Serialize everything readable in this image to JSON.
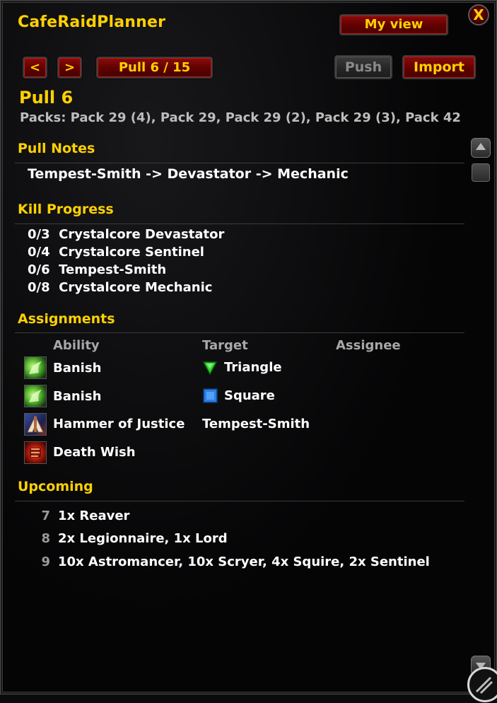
{
  "window": {
    "title": "CafeRaidPlanner",
    "close_glyph": "X"
  },
  "header": {
    "my_view_label": "My view",
    "prev_label": "<",
    "next_label": ">",
    "pull_indicator": "Pull 6 / 15",
    "push_label": "Push",
    "import_label": "Import"
  },
  "pull": {
    "title": "Pull 6",
    "packs": "Packs: Pack 29 (4), Pack 29, Pack 29 (2), Pack 29 (3), Pack 42"
  },
  "pull_notes": {
    "heading": "Pull Notes",
    "text": "Tempest-Smith -> Devastator -> Mechanic"
  },
  "kill_progress": {
    "heading": "Kill Progress",
    "items": [
      {
        "count": "0/3",
        "name": "Crystalcore Devastator"
      },
      {
        "count": "0/4",
        "name": "Crystalcore Sentinel"
      },
      {
        "count": "0/6",
        "name": "Tempest-Smith"
      },
      {
        "count": "0/8",
        "name": "Crystalcore Mechanic"
      }
    ]
  },
  "assignments": {
    "heading": "Assignments",
    "columns": {
      "ability": "Ability",
      "target": "Target",
      "assignee": "Assignee"
    },
    "rows": [
      {
        "icon": "banish-icon",
        "ability": "Banish",
        "target_icon": "triangle-marker-icon",
        "target": "Triangle",
        "assignee": ""
      },
      {
        "icon": "banish-icon",
        "ability": "Banish",
        "target_icon": "square-marker-icon",
        "target": "Square",
        "assignee": ""
      },
      {
        "icon": "hammer-of-justice-icon",
        "ability": "Hammer of Justice",
        "target_icon": "",
        "target": "Tempest-Smith",
        "assignee": ""
      },
      {
        "icon": "death-wish-icon",
        "ability": "Death Wish",
        "target_icon": "",
        "target": "",
        "assignee": ""
      }
    ]
  },
  "upcoming": {
    "heading": "Upcoming",
    "items": [
      {
        "number": "7",
        "text": "1x Reaver"
      },
      {
        "number": "8",
        "text": "2x Legionnaire, 1x Lord"
      },
      {
        "number": "9",
        "text": "10x Astromancer, 10x Scryer, 4x Squire, 2x Sentinel"
      }
    ]
  },
  "colors": {
    "accent_gold": "#ffd100",
    "button_red": "#6f0505",
    "button_disabled": "#2c2c2c",
    "triangle_marker": "#2fd02f",
    "square_marker": "#2a7fe8"
  }
}
